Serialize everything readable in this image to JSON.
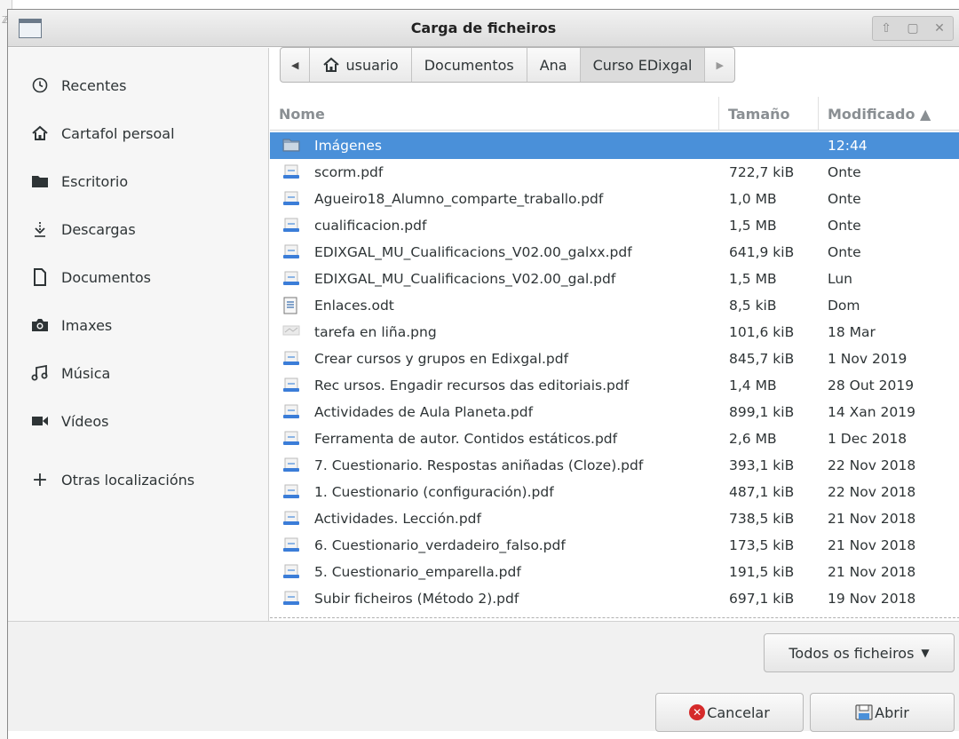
{
  "window": {
    "title": "Carga de ficheiros",
    "controls": [
      "up-arrow-icon",
      "maximize-icon",
      "close-icon"
    ]
  },
  "sidebar": {
    "items": [
      {
        "label": "Recentes",
        "icon": "clock-icon"
      },
      {
        "label": "Cartafol persoal",
        "icon": "home-icon"
      },
      {
        "label": "Escritorio",
        "icon": "folder-icon"
      },
      {
        "label": "Descargas",
        "icon": "download-icon"
      },
      {
        "label": "Documentos",
        "icon": "document-icon"
      },
      {
        "label": "Imaxes",
        "icon": "camera-icon"
      },
      {
        "label": "Música",
        "icon": "music-icon"
      },
      {
        "label": "Vídeos",
        "icon": "video-camera-icon"
      },
      {
        "label": "Otras localizacións",
        "icon": "plus-icon"
      }
    ]
  },
  "pathbar": {
    "segments": [
      "usuario",
      "Documentos",
      "Ana",
      "Curso EDixgal"
    ],
    "active": "Curso EDixgal"
  },
  "columns": {
    "name": "Nome",
    "size": "Tamaño",
    "modified": "Modificado ▲"
  },
  "files": [
    {
      "name": "Imágenes",
      "size": "",
      "modified": "12:44",
      "icon": "folder-icon",
      "selected": true
    },
    {
      "name": "scorm.pdf",
      "size": "722,7 kiB",
      "modified": "Onte",
      "icon": "pdf-icon"
    },
    {
      "name": "Agueiro18_Alumno_comparte_traballo.pdf",
      "size": "1,0 MB",
      "modified": "Onte",
      "icon": "pdf-icon"
    },
    {
      "name": "cualificacion.pdf",
      "size": "1,5 MB",
      "modified": "Onte",
      "icon": "pdf-icon"
    },
    {
      "name": "EDIXGAL_MU_Cualificacions_V02.00_galxx.pdf",
      "size": "641,9 kiB",
      "modified": "Onte",
      "icon": "pdf-icon"
    },
    {
      "name": "EDIXGAL_MU_Cualificacions_V02.00_gal.pdf",
      "size": "1,5 MB",
      "modified": "Lun",
      "icon": "pdf-icon"
    },
    {
      "name": "Enlaces.odt",
      "size": "8,5 kiB",
      "modified": "Dom",
      "icon": "document-icon"
    },
    {
      "name": "tarefa en liña.png",
      "size": "101,6 kiB",
      "modified": "18 Mar",
      "icon": "image-icon"
    },
    {
      "name": "Crear cursos y grupos en Edixgal.pdf",
      "size": "845,7 kiB",
      "modified": "1 Nov 2019",
      "icon": "pdf-icon"
    },
    {
      "name": "Rec ursos. Engadir recursos das editoriais.pdf",
      "size": "1,4 MB",
      "modified": "28 Out 2019",
      "icon": "pdf-icon"
    },
    {
      "name": "Actividades de Aula Planeta.pdf",
      "size": "899,1 kiB",
      "modified": "14 Xan 2019",
      "icon": "pdf-icon"
    },
    {
      "name": "Ferramenta de autor. Contidos estáticos.pdf",
      "size": "2,6 MB",
      "modified": "1 Dec 2018",
      "icon": "pdf-icon"
    },
    {
      "name": "7. Cuestionario. Respostas aniñadas (Cloze).pdf",
      "size": "393,1 kiB",
      "modified": "22 Nov 2018",
      "icon": "pdf-icon"
    },
    {
      "name": "1. Cuestionario (configuración).pdf",
      "size": "487,1 kiB",
      "modified": "22 Nov 2018",
      "icon": "pdf-icon"
    },
    {
      "name": "Actividades. Lección.pdf",
      "size": "738,5 kiB",
      "modified": "21 Nov 2018",
      "icon": "pdf-icon"
    },
    {
      "name": "6. Cuestionario_verdadeiro_falso.pdf",
      "size": "173,5 kiB",
      "modified": "21 Nov 2018",
      "icon": "pdf-icon"
    },
    {
      "name": "5. Cuestionario_emparella.pdf",
      "size": "191,5 kiB",
      "modified": "21 Nov 2018",
      "icon": "pdf-icon"
    },
    {
      "name": "Subir ficheiros (Método 2).pdf",
      "size": "697,1 kiB",
      "modified": "19 Nov 2018",
      "icon": "pdf-icon"
    }
  ],
  "footer": {
    "filter_label": "Todos os ficheiros",
    "cancel_label": "Cancelar",
    "open_label": "Abrir"
  },
  "colors": {
    "selection": "#4a90d9",
    "cancel_icon": "#d52a2a"
  }
}
